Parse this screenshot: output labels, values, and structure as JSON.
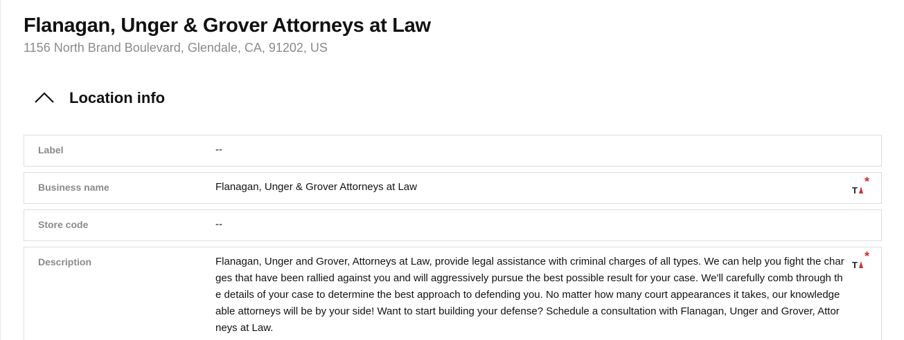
{
  "header": {
    "title": "Flanagan, Unger & Grover Attorneys at Law",
    "address": "1156 North Brand Boulevard, Glendale, CA, 91202, US"
  },
  "section": {
    "title": "Location info",
    "collapse_icon": "chevron-up-icon"
  },
  "fields": [
    {
      "label": "Label",
      "value": "--",
      "has_translate": false
    },
    {
      "label": "Business name",
      "value": "Flanagan, Unger & Grover Attorneys at Law",
      "has_translate": true
    },
    {
      "label": "Store code",
      "value": "--",
      "has_translate": false
    },
    {
      "label": "Description",
      "value": "Flanagan, Unger and Grover, Attorneys at Law, provide legal assistance with criminal charges of all types. We can help you fight the charges that have been rallied against you and will aggressively pursue the best possible result for your case. We'll carefully comb through the details of your case to determine the best approach to defending you. No matter how many court appearances it takes, our knowledgeable attorneys will be by your side! Want to start building your defense? Schedule a consultation with Flanagan, Unger and Grover, Attorneys at Law.",
      "has_translate": true
    }
  ],
  "icons": {
    "translate": "translate-icon"
  },
  "colors": {
    "icon_red": "#d32f2f",
    "icon_dark": "#222222",
    "muted_text": "#8a8a8a",
    "border": "#dadce0"
  }
}
